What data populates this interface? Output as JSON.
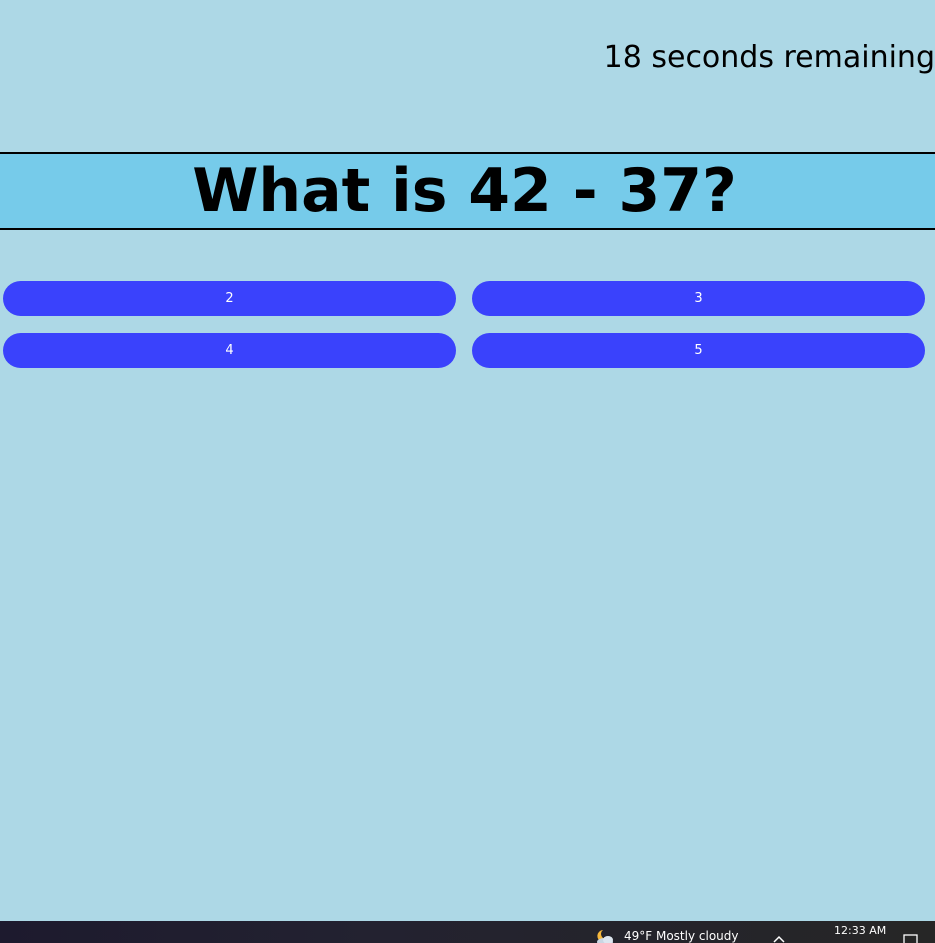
{
  "quiz": {
    "timer_text": "18 seconds remaining",
    "question": "What is 42 - 37?",
    "answers": [
      "2",
      "3",
      "4",
      "5"
    ]
  },
  "taskbar": {
    "weather_text": "49°F  Mostly cloudy",
    "weather_icon": "partly-cloudy-night-icon",
    "clock_time": "12:33 AM"
  },
  "colors": {
    "background": "#add8e6",
    "question_box": "#76cbea",
    "answer_button": "#3a42fc",
    "answer_text": "#ffffff"
  }
}
